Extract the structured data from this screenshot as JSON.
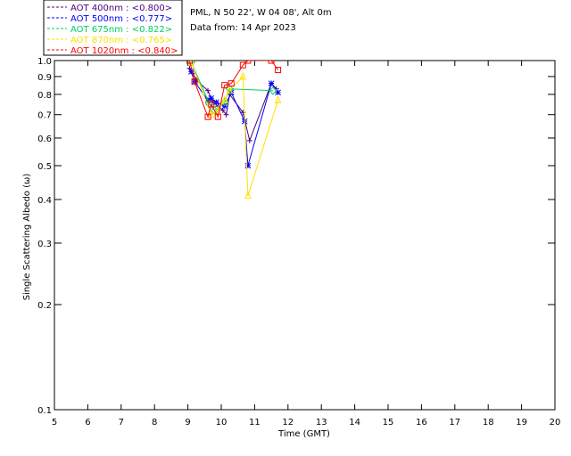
{
  "info": {
    "line1": "PML, N 50 22', W 04 08', Alt 0m",
    "line2": "Data from: 14 Apr 2023"
  },
  "chart_data": {
    "type": "scatter",
    "xlabel": "Time (GMT)",
    "ylabel": "Single Scattering Albedo (ω)",
    "xlim": [
      5,
      20
    ],
    "ylim": [
      0.1,
      1.0
    ],
    "yscale": "log",
    "x_ticks": [
      "5",
      "6",
      "7",
      "8",
      "9",
      "10",
      "11",
      "12",
      "13",
      "14",
      "15",
      "16",
      "17",
      "18",
      "19",
      "20"
    ],
    "y_ticks": [
      "0.1",
      "0.2",
      "0.3",
      "0.4",
      "0.5",
      "0.6",
      "0.7",
      "0.8",
      "0.9",
      "1.0"
    ],
    "grid": false,
    "legend_position": "top-left",
    "series": [
      {
        "name": "AOT  400nm : <0.800>",
        "color": "#4b0082",
        "marker": "plus",
        "x": [
          9.05,
          9.15,
          9.25,
          9.6,
          9.75,
          9.9,
          10.05,
          10.15,
          10.25,
          10.65,
          10.85,
          11.5,
          11.65
        ],
        "y": [
          0.95,
          0.92,
          0.88,
          0.82,
          0.76,
          0.74,
          0.72,
          0.7,
          0.8,
          0.71,
          0.59,
          0.86,
          0.83
        ]
      },
      {
        "name": "AOT  500nm : <0.777>",
        "color": "#0000ff",
        "marker": "star",
        "x": [
          9.1,
          9.2,
          9.6,
          9.7,
          9.85,
          10.1,
          10.3,
          10.7,
          10.8,
          11.5,
          11.7
        ],
        "y": [
          0.93,
          0.87,
          0.77,
          0.78,
          0.76,
          0.74,
          0.81,
          0.67,
          0.5,
          0.86,
          0.81
        ]
      },
      {
        "name": "AOT  675nm : <0.822>",
        "color": "#00cc66",
        "marker": "diamond",
        "x": [
          9.1,
          9.65,
          9.8,
          10.1,
          10.25,
          11.55
        ],
        "y": [
          0.99,
          0.75,
          0.72,
          0.76,
          0.83,
          0.82
        ]
      },
      {
        "name": "AOT  870nm : <0.765>",
        "color": "#ffe000",
        "marker": "triangle",
        "x": [
          9.1,
          9.7,
          9.9,
          10.1,
          10.25,
          10.65,
          10.8,
          11.7
        ],
        "y": [
          0.99,
          0.7,
          0.72,
          0.77,
          0.82,
          0.9,
          0.41,
          0.77
        ]
      },
      {
        "name": "AOT 1020nm : <0.840>",
        "color": "#ff0000",
        "marker": "square",
        "x": [
          9.05,
          9.2,
          9.6,
          9.7,
          9.9,
          10.1,
          10.3,
          10.65,
          10.8,
          11.5,
          11.7
        ],
        "y": [
          1.0,
          0.87,
          0.69,
          0.75,
          0.69,
          0.85,
          0.86,
          0.97,
          1.0,
          1.0,
          0.94
        ]
      }
    ]
  }
}
